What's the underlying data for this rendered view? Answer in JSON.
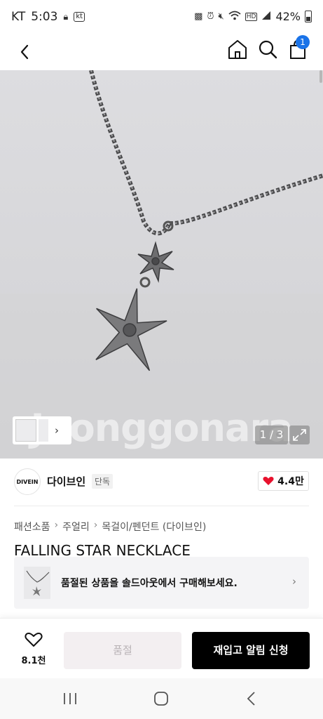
{
  "status_bar": {
    "carrier": "KT",
    "time": "5:03",
    "carrier_badge": "kt",
    "battery": "42%"
  },
  "app_bar": {
    "cart_count": "1"
  },
  "hero": {
    "watermark": "Joonggonara",
    "pager": "1 / 3"
  },
  "brand": {
    "logo_text": "DIVEIN",
    "name": "다이브인",
    "badge": "단독",
    "likes": "4.4만"
  },
  "breadcrumb": [
    "패션소품",
    "주얼리",
    "목걸이/펜던트 (다이브인)"
  ],
  "product": {
    "title": "FALLING STAR NECKLACE"
  },
  "soldout_notice": {
    "text": "품절된 상품을 솔드아웃에서 구매해보세요."
  },
  "action_bar": {
    "wish_count": "8.1천",
    "soldout_label": "품절",
    "restock_label": "재입고 알림 신청"
  },
  "colors": {
    "accent": "#1a73e8",
    "like_heart": "#e8112d",
    "primary_button": "#000000"
  }
}
